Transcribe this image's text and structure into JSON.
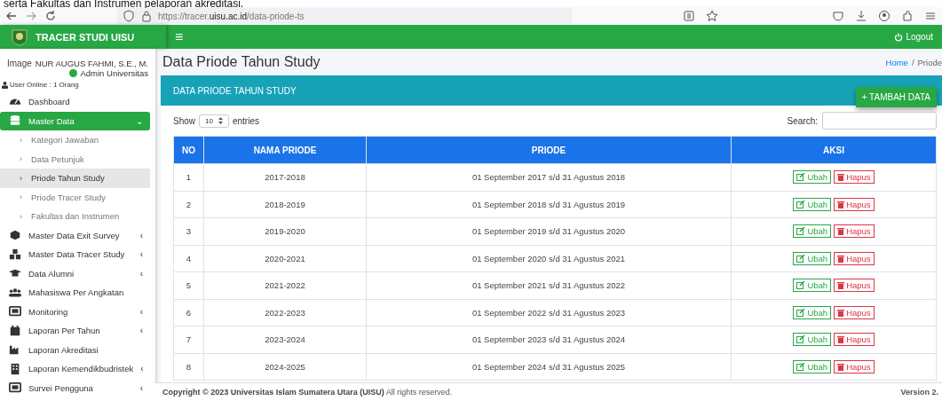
{
  "caption": "serta Fakultas dan Instrumen pelaporan akreditasi.",
  "browser": {
    "url_prefix": "https://tracer.",
    "url_domain": "uisu.ac.id",
    "url_path": "/data-priode-ts"
  },
  "header": {
    "brand": "TRACER STUDI UISU",
    "menu_glyph": "≡",
    "logout": "Logout"
  },
  "user": {
    "image_alt": "Image",
    "name": "NUR AUGUS FAHMI, S.E., M.",
    "role": "Admin Universitas",
    "online": "User Online : 1 Orang"
  },
  "sidebar": {
    "items": [
      {
        "label": "Dashboard",
        "selected": false
      },
      {
        "label": "Master Data",
        "selected": true,
        "caret": "⌄",
        "children": [
          {
            "bullet": "›",
            "label": "Kategori Jawaban",
            "selected": false
          },
          {
            "bullet": "›",
            "label": "Data Petunjuk",
            "selected": false
          },
          {
            "bullet": "›",
            "label": "Priode Tahun Study",
            "selected": true
          },
          {
            "bullet": "›",
            "label": "Priode Tracer Study",
            "selected": false
          },
          {
            "bullet": "›",
            "label": "Fakultas dan Instrumen",
            "selected": false
          }
        ]
      },
      {
        "label": "Master Data Exit Survey",
        "selected": false,
        "caret": "‹"
      },
      {
        "label": "Master Data Tracer Study",
        "selected": false,
        "caret": "‹"
      },
      {
        "label": "Data Alumni",
        "selected": false,
        "caret": "‹"
      },
      {
        "label": "Mahasiswa Per Angkatan",
        "selected": false
      },
      {
        "label": "Monitoring",
        "selected": false,
        "caret": "‹"
      },
      {
        "label": "Laporan Per Tahun",
        "selected": false,
        "caret": "‹"
      },
      {
        "label": "Laporan Akreditasi",
        "selected": false
      },
      {
        "label": "Laporan Kemendikbudristek",
        "selected": false,
        "caret": "‹"
      },
      {
        "label": "Survei Pengguna",
        "selected": false,
        "caret": "‹"
      }
    ]
  },
  "page": {
    "title": "Data Priode Tahun Study",
    "breadcrumb": [
      {
        "label": "Home",
        "kind": "link"
      },
      {
        "label": "/",
        "kind": "separator"
      },
      {
        "label": "Priode",
        "kind": "current"
      }
    ]
  },
  "card": {
    "title": "DATA PRIODE TAHUN STUDY",
    "add_button": "+ TAMBAH DATA",
    "show_label": "Show",
    "entries_value": "10",
    "entries_label": "entries",
    "search_label": "Search:"
  },
  "table": {
    "columns": [
      "NO",
      "NAMA PRIODE",
      "PRIODE",
      "AKSI"
    ],
    "rows": [
      {
        "no": "1",
        "nama": "2017-2018",
        "priode": "01 September 2017 s/d 31 Agustus 2018",
        "actions": [
          {
            "kind": "edit",
            "label": "Ubah"
          },
          {
            "kind": "delete",
            "label": "Hapus"
          }
        ]
      },
      {
        "no": "2",
        "nama": "2018-2019",
        "priode": "01 September 2018 s/d 31 Agustus 2019",
        "actions": [
          {
            "kind": "edit",
            "label": "Ubah"
          },
          {
            "kind": "delete",
            "label": "Hapus"
          }
        ]
      },
      {
        "no": "3",
        "nama": "2019-2020",
        "priode": "01 September 2019 s/d 31 Agustus 2020",
        "actions": [
          {
            "kind": "edit",
            "label": "Ubah"
          },
          {
            "kind": "delete",
            "label": "Hapus"
          }
        ]
      },
      {
        "no": "4",
        "nama": "2020-2021",
        "priode": "01 September 2020 s/d 31 Agustus 2021",
        "actions": [
          {
            "kind": "edit",
            "label": "Ubah"
          },
          {
            "kind": "delete",
            "label": "Hapus"
          }
        ]
      },
      {
        "no": "5",
        "nama": "2021-2022",
        "priode": "01 September 2021 s/d 31 Agustus 2022",
        "actions": [
          {
            "kind": "edit",
            "label": "Ubah"
          },
          {
            "kind": "delete",
            "label": "Hapus"
          }
        ]
      },
      {
        "no": "6",
        "nama": "2022-2023",
        "priode": "01 September 2022 s/d 31 Agustus 2023",
        "actions": [
          {
            "kind": "edit",
            "label": "Ubah"
          },
          {
            "kind": "delete",
            "label": "Hapus"
          }
        ]
      },
      {
        "no": "7",
        "nama": "2023-2024",
        "priode": "01 September 2023 s/d 31 Agustus 2024",
        "actions": [
          {
            "kind": "edit",
            "label": "Ubah"
          },
          {
            "kind": "delete",
            "label": "Hapus"
          }
        ]
      },
      {
        "no": "8",
        "nama": "2024-2025",
        "priode": "01 September 2024 s/d 31 Agustus 2025",
        "actions": [
          {
            "kind": "edit",
            "label": "Ubah"
          },
          {
            "kind": "delete",
            "label": "Hapus"
          }
        ]
      }
    ]
  },
  "footer": {
    "copyright": "**Copyright © 2023 Universitas Islam Sumatera Utara (UISU)** All rights reserved.",
    "version": "Version 2."
  }
}
